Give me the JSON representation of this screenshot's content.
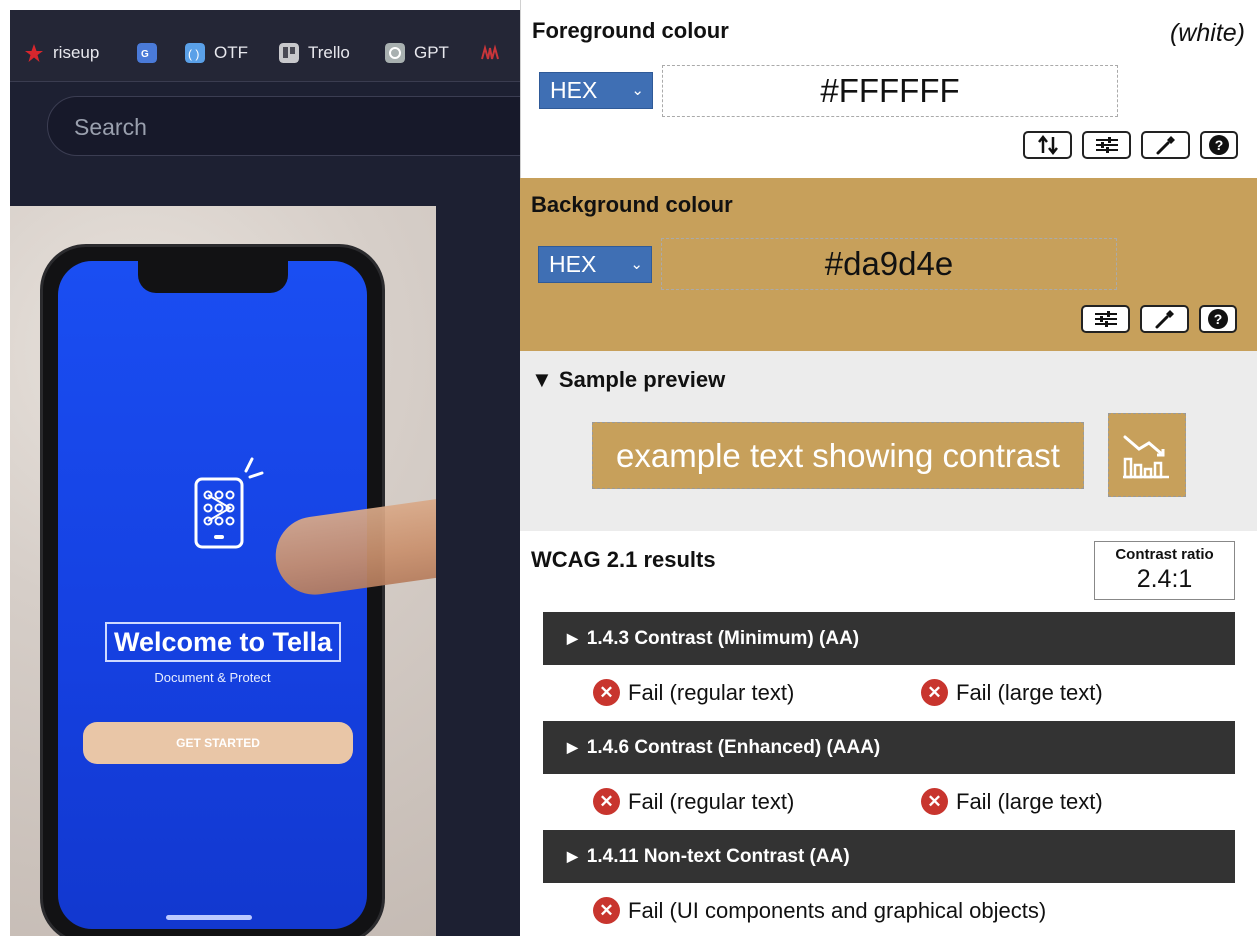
{
  "bookmarks": [
    {
      "label": "riseup",
      "icon": "riseup-icon",
      "color": "#d8262d"
    },
    {
      "label": "",
      "icon": "google-translate-icon",
      "color": "#4a7ad8"
    },
    {
      "label": "OTF",
      "icon": "otf-icon",
      "color": "#5aa0e8"
    },
    {
      "label": "Trello",
      "icon": "trello-icon",
      "color": "#c8c8cc"
    },
    {
      "label": "GPT",
      "icon": "gpt-icon",
      "color": "#a8b0b0"
    },
    {
      "label": "",
      "icon": "red-bookmark-icon",
      "color": "#c8353a"
    }
  ],
  "search": {
    "placeholder": "Search"
  },
  "phone": {
    "welcome": "Welcome to Tella",
    "subtitle": "Document & Protect",
    "button": "GET STARTED"
  },
  "foreground": {
    "title": "Foreground colour",
    "note": "(white)",
    "format": "HEX",
    "value": "#FFFFFF",
    "color": "#FFFFFF"
  },
  "background": {
    "title": "Background colour",
    "format": "HEX",
    "value": "#da9d4e",
    "color": "#c7a05b"
  },
  "preview": {
    "label": "Sample preview",
    "text": "example text showing contrast"
  },
  "results": {
    "title": "WCAG 2.1 results",
    "ratio_label": "Contrast ratio",
    "ratio_value": "2.4:1",
    "criteria": [
      {
        "label": "1.4.3 Contrast (Minimum) (AA)",
        "results": [
          "Fail (regular text)",
          "Fail (large text)"
        ]
      },
      {
        "label": "1.4.6 Contrast (Enhanced) (AAA)",
        "results": [
          "Fail (regular text)",
          "Fail (large text)"
        ]
      },
      {
        "label": "1.4.11 Non-text Contrast (AA)",
        "results": [
          "Fail (UI components and graphical objects)"
        ]
      }
    ],
    "fail_color": "#c8352e"
  }
}
